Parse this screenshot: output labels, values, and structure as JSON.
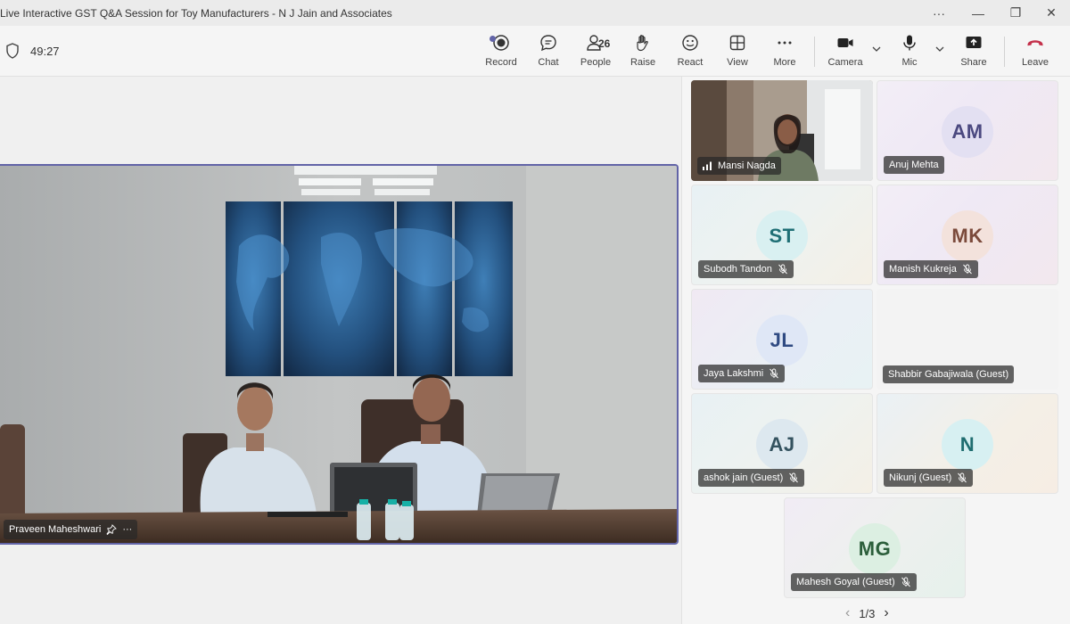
{
  "window": {
    "title": "Live Interactive GST Q&A Session for Toy Manufacturers - N J Jain and Associates",
    "more": "···",
    "minimize": "—",
    "maximize": "❐",
    "close": "✕"
  },
  "toolbar": {
    "timer": "49:27",
    "people_count": "26",
    "buttons": {
      "record": "Record",
      "chat": "Chat",
      "people": "People",
      "raise": "Raise",
      "react": "React",
      "view": "View",
      "more": "More",
      "camera": "Camera",
      "mic": "Mic",
      "share": "Share",
      "leave": "Leave"
    },
    "colors": {
      "leave": "#c4314b",
      "accent": "#6264a7"
    }
  },
  "main_video": {
    "name": "Praveen Maheshwari",
    "more": "···"
  },
  "participants": [
    {
      "name": "Mansi Nagda",
      "initials": "",
      "video": true,
      "muted": false
    },
    {
      "name": "Anuj Mehta",
      "initials": "AM",
      "video": false,
      "muted": false
    },
    {
      "name": "Subodh Tandon",
      "initials": "ST",
      "video": false,
      "muted": true
    },
    {
      "name": "Manish Kukreja",
      "initials": "MK",
      "video": false,
      "muted": true
    },
    {
      "name": "Jaya Lakshmi",
      "initials": "JL",
      "video": false,
      "muted": true
    },
    {
      "name": "Shabbir Gabajiwala (Guest)",
      "initials": "",
      "video": false,
      "muted": false
    },
    {
      "name": "ashok jain (Guest)",
      "initials": "AJ",
      "video": false,
      "muted": true
    },
    {
      "name": "Nikunj (Guest)",
      "initials": "N",
      "video": false,
      "muted": true
    },
    {
      "name": "Mahesh Goyal (Guest)",
      "initials": "MG",
      "video": false,
      "muted": true
    }
  ],
  "pager": {
    "label": "1/3",
    "prev": "‹",
    "next": "›"
  }
}
